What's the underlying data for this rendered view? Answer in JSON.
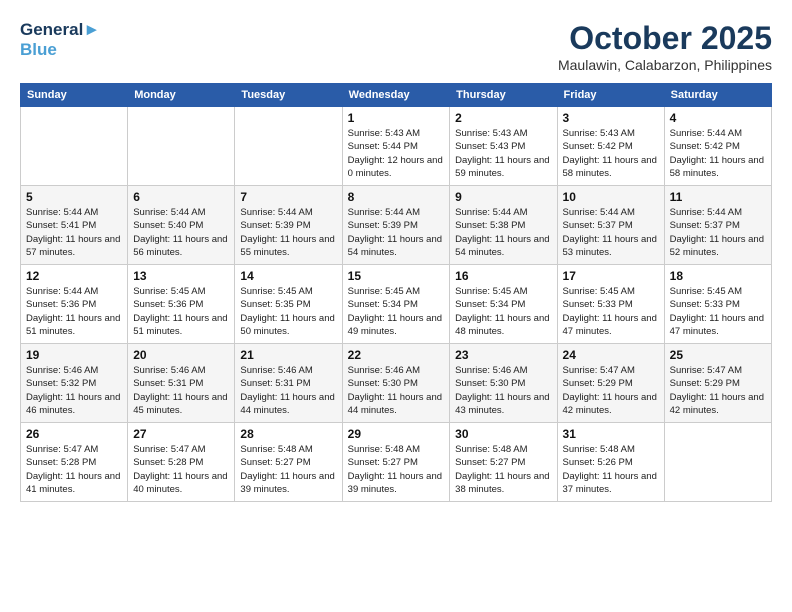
{
  "header": {
    "logo_line1": "General",
    "logo_line2": "Blue",
    "title": "October 2025",
    "subtitle": "Maulawin, Calabarzon, Philippines"
  },
  "days_of_week": [
    "Sunday",
    "Monday",
    "Tuesday",
    "Wednesday",
    "Thursday",
    "Friday",
    "Saturday"
  ],
  "weeks": [
    [
      {
        "day": "",
        "detail": ""
      },
      {
        "day": "",
        "detail": ""
      },
      {
        "day": "",
        "detail": ""
      },
      {
        "day": "1",
        "detail": "Sunrise: 5:43 AM\nSunset: 5:44 PM\nDaylight: 12 hours\nand 0 minutes."
      },
      {
        "day": "2",
        "detail": "Sunrise: 5:43 AM\nSunset: 5:43 PM\nDaylight: 11 hours\nand 59 minutes."
      },
      {
        "day": "3",
        "detail": "Sunrise: 5:43 AM\nSunset: 5:42 PM\nDaylight: 11 hours\nand 58 minutes."
      },
      {
        "day": "4",
        "detail": "Sunrise: 5:44 AM\nSunset: 5:42 PM\nDaylight: 11 hours\nand 58 minutes."
      }
    ],
    [
      {
        "day": "5",
        "detail": "Sunrise: 5:44 AM\nSunset: 5:41 PM\nDaylight: 11 hours\nand 57 minutes."
      },
      {
        "day": "6",
        "detail": "Sunrise: 5:44 AM\nSunset: 5:40 PM\nDaylight: 11 hours\nand 56 minutes."
      },
      {
        "day": "7",
        "detail": "Sunrise: 5:44 AM\nSunset: 5:39 PM\nDaylight: 11 hours\nand 55 minutes."
      },
      {
        "day": "8",
        "detail": "Sunrise: 5:44 AM\nSunset: 5:39 PM\nDaylight: 11 hours\nand 54 minutes."
      },
      {
        "day": "9",
        "detail": "Sunrise: 5:44 AM\nSunset: 5:38 PM\nDaylight: 11 hours\nand 54 minutes."
      },
      {
        "day": "10",
        "detail": "Sunrise: 5:44 AM\nSunset: 5:37 PM\nDaylight: 11 hours\nand 53 minutes."
      },
      {
        "day": "11",
        "detail": "Sunrise: 5:44 AM\nSunset: 5:37 PM\nDaylight: 11 hours\nand 52 minutes."
      }
    ],
    [
      {
        "day": "12",
        "detail": "Sunrise: 5:44 AM\nSunset: 5:36 PM\nDaylight: 11 hours\nand 51 minutes."
      },
      {
        "day": "13",
        "detail": "Sunrise: 5:45 AM\nSunset: 5:36 PM\nDaylight: 11 hours\nand 51 minutes."
      },
      {
        "day": "14",
        "detail": "Sunrise: 5:45 AM\nSunset: 5:35 PM\nDaylight: 11 hours\nand 50 minutes."
      },
      {
        "day": "15",
        "detail": "Sunrise: 5:45 AM\nSunset: 5:34 PM\nDaylight: 11 hours\nand 49 minutes."
      },
      {
        "day": "16",
        "detail": "Sunrise: 5:45 AM\nSunset: 5:34 PM\nDaylight: 11 hours\nand 48 minutes."
      },
      {
        "day": "17",
        "detail": "Sunrise: 5:45 AM\nSunset: 5:33 PM\nDaylight: 11 hours\nand 47 minutes."
      },
      {
        "day": "18",
        "detail": "Sunrise: 5:45 AM\nSunset: 5:33 PM\nDaylight: 11 hours\nand 47 minutes."
      }
    ],
    [
      {
        "day": "19",
        "detail": "Sunrise: 5:46 AM\nSunset: 5:32 PM\nDaylight: 11 hours\nand 46 minutes."
      },
      {
        "day": "20",
        "detail": "Sunrise: 5:46 AM\nSunset: 5:31 PM\nDaylight: 11 hours\nand 45 minutes."
      },
      {
        "day": "21",
        "detail": "Sunrise: 5:46 AM\nSunset: 5:31 PM\nDaylight: 11 hours\nand 44 minutes."
      },
      {
        "day": "22",
        "detail": "Sunrise: 5:46 AM\nSunset: 5:30 PM\nDaylight: 11 hours\nand 44 minutes."
      },
      {
        "day": "23",
        "detail": "Sunrise: 5:46 AM\nSunset: 5:30 PM\nDaylight: 11 hours\nand 43 minutes."
      },
      {
        "day": "24",
        "detail": "Sunrise: 5:47 AM\nSunset: 5:29 PM\nDaylight: 11 hours\nand 42 minutes."
      },
      {
        "day": "25",
        "detail": "Sunrise: 5:47 AM\nSunset: 5:29 PM\nDaylight: 11 hours\nand 42 minutes."
      }
    ],
    [
      {
        "day": "26",
        "detail": "Sunrise: 5:47 AM\nSunset: 5:28 PM\nDaylight: 11 hours\nand 41 minutes."
      },
      {
        "day": "27",
        "detail": "Sunrise: 5:47 AM\nSunset: 5:28 PM\nDaylight: 11 hours\nand 40 minutes."
      },
      {
        "day": "28",
        "detail": "Sunrise: 5:48 AM\nSunset: 5:27 PM\nDaylight: 11 hours\nand 39 minutes."
      },
      {
        "day": "29",
        "detail": "Sunrise: 5:48 AM\nSunset: 5:27 PM\nDaylight: 11 hours\nand 39 minutes."
      },
      {
        "day": "30",
        "detail": "Sunrise: 5:48 AM\nSunset: 5:27 PM\nDaylight: 11 hours\nand 38 minutes."
      },
      {
        "day": "31",
        "detail": "Sunrise: 5:48 AM\nSunset: 5:26 PM\nDaylight: 11 hours\nand 37 minutes."
      },
      {
        "day": "",
        "detail": ""
      }
    ]
  ]
}
